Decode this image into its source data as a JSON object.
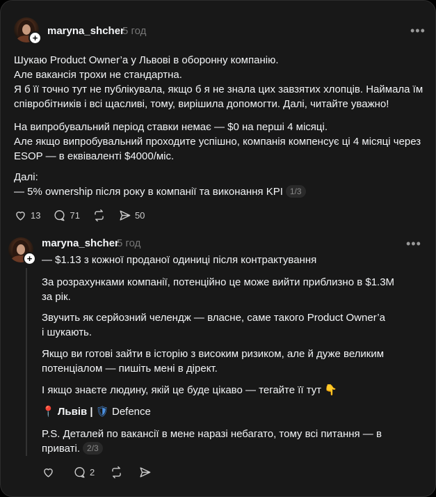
{
  "post1": {
    "username": "maryna_shcher",
    "time": "5 год",
    "more": "•••",
    "body": "Шукаю Product Owner’а у Львові в оборонну компанію.\nАле вакансія трохи не стандартна.\nЯ б її точно тут не публікувала, якщо б я не знала цих завзятих хлопців. Наймала їм співробітників і всі щасливі, тому, вирішила допомогти. Далі, читайте уважно!",
    "body2": "На випробувальний період ставки немає — $0 на перші 4 місяці.\nАле якщо випробувальний проходите успішно, компанія компенсує ці 4 місяці через ESOP — в еквіваленті $4000/міс.",
    "body3a": "Далі:",
    "body3b": "— 5% ownership після року в компанії та виконання KPI",
    "page": "1/3",
    "likes": "13",
    "replies": "71",
    "shares": "50"
  },
  "post2": {
    "username": "maryna_shcher",
    "time": "5 год",
    "more": "•••",
    "line1": "— $1.13 з кожної проданої одиниці після контрактування",
    "p1": "За розрахунками компанії, потенційно це може вийти приблизно в $1.3M\nза рік.",
    "p2": "Звучить як серйозний челендж — власне, самe такого Product Owner’а\nі шукають.",
    "p3": "Якщо ви готові зайти в історію з високим ризиком, але й дуже великим\nпотенціалом — пишіть мені в дірект.",
    "p4": "І якщо знаєте людину, якій це буде цікаво — тегайте її тут",
    "p4_emoji": "👇",
    "p5_pin": "📍",
    "p5_city": "Львів |",
    "p5_shield": "🛡",
    "p5_tag": "Defence",
    "p6": "P.S. Деталей по вакансії в мене наразі небагато, тому всі питання — в\nприваті.",
    "page": "2/3",
    "replies": "2"
  }
}
